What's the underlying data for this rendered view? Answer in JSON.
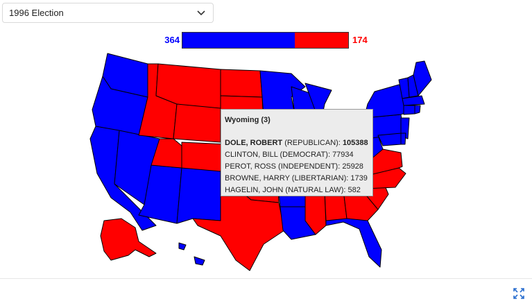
{
  "selector": {
    "value": "1996 Election",
    "icon": "chevron-down-icon"
  },
  "tally": {
    "dem_votes": "364",
    "rep_votes": "174",
    "dem_share": 0.6766,
    "dem_color": "#0000ff",
    "rep_color": "#ff0000"
  },
  "tooltip": {
    "title": "Wyoming (3)",
    "rows": [
      {
        "name": "DOLE, ROBERT",
        "party": "(REPUBLICAN):",
        "votes": "105388",
        "winner": true
      },
      {
        "name": "CLINTON, BILL",
        "party": "(DEMOCRAT):",
        "votes": "77934",
        "winner": false
      },
      {
        "name": "PEROT, ROSS",
        "party": "(INDEPENDENT):",
        "votes": "25928",
        "winner": false
      },
      {
        "name": "BROWNE, HARRY",
        "party": "(LIBERTARIAN):",
        "votes": "1739",
        "winner": false
      },
      {
        "name": "HAGELIN, JOHN",
        "party": "(NATURAL LAW):",
        "votes": "582",
        "winner": false
      }
    ]
  },
  "states": {
    "blue": [
      "WA",
      "OR",
      "CA",
      "NV",
      "AZ",
      "NM",
      "MN",
      "IA",
      "WI",
      "MI",
      "IL",
      "MO",
      "AR",
      "LA",
      "TN",
      "KY",
      "OH",
      "WV",
      "PA",
      "NY",
      "ME",
      "NH",
      "VT",
      "MA",
      "RI",
      "CT",
      "NJ",
      "DE",
      "MD",
      "FL",
      "HI"
    ],
    "red": [
      "ID",
      "MT",
      "WY",
      "UT",
      "CO",
      "ND",
      "SD",
      "NE",
      "KS",
      "OK",
      "TX",
      "MS",
      "AL",
      "GA",
      "SC",
      "NC",
      "VA",
      "IN",
      "AK"
    ],
    "highlight": "WY"
  },
  "footer": {
    "expand_icon": "expand-icon"
  }
}
